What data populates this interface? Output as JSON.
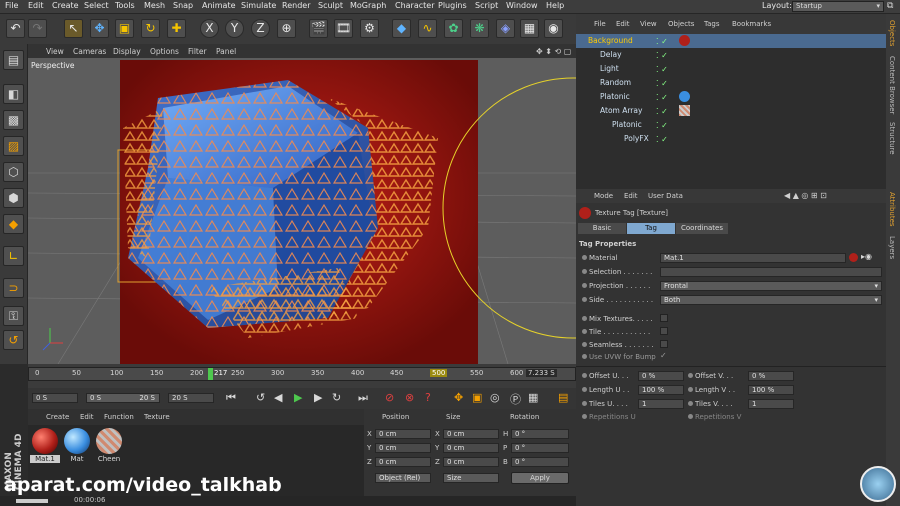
{
  "menu": {
    "items": [
      "File",
      "Edit",
      "Create",
      "Select",
      "Tools",
      "Mesh",
      "Snap",
      "Animate",
      "Simulate",
      "Render",
      "Sculpt",
      "MoGraph",
      "Character",
      "Plugins",
      "Script",
      "Window",
      "Help"
    ],
    "layout_label": "Layout:",
    "layout_value": "Startup"
  },
  "viewport": {
    "menu": [
      "View",
      "Cameras",
      "Display",
      "Options",
      "Filter",
      "Panel"
    ],
    "name": "Perspective"
  },
  "timeline": {
    "ticks": [
      "0",
      "50",
      "100",
      "150",
      "200",
      "250",
      "300",
      "350",
      "400",
      "450",
      "500",
      "550",
      "600"
    ],
    "current_frame": "217",
    "marker": "500",
    "time_readout": "7.233 S"
  },
  "transport": {
    "start": "0 S",
    "range_left": "0 S",
    "range_right": "20 S",
    "end": "20 S"
  },
  "materials": {
    "menu": [
      "Create",
      "Edit",
      "Function",
      "Texture"
    ],
    "items": [
      {
        "label": "Mat.1",
        "color": "#b0201a"
      },
      {
        "label": "Mat",
        "color": "#3a8ee0"
      },
      {
        "label": "Cheen",
        "color": "#c0a090"
      }
    ]
  },
  "coords": {
    "headers": [
      "Position",
      "Size",
      "Rotation"
    ],
    "rows": [
      {
        "axis": "X",
        "pos": "0 cm",
        "size_axis": "X",
        "size": "0 cm",
        "rot_axis": "H",
        "rot": "0 °"
      },
      {
        "axis": "Y",
        "pos": "0 cm",
        "size_axis": "Y",
        "size": "0 cm",
        "rot_axis": "P",
        "rot": "0 °"
      },
      {
        "axis": "Z",
        "pos": "0 cm",
        "size_axis": "Z",
        "size": "0 cm",
        "rot_axis": "B",
        "rot": "0 °"
      }
    ],
    "mode": "Object (Rel)",
    "size_mode": "Size",
    "apply": "Apply"
  },
  "objects": {
    "menu": [
      "File",
      "Edit",
      "View",
      "Objects",
      "Tags",
      "Bookmarks"
    ],
    "rows": [
      {
        "name": "Background",
        "indent": 0,
        "selected": true
      },
      {
        "name": "Delay",
        "indent": 0
      },
      {
        "name": "Light",
        "indent": 0
      },
      {
        "name": "Random",
        "indent": 0
      },
      {
        "name": "Platonic",
        "indent": 0
      },
      {
        "name": "Atom Array",
        "indent": 0
      },
      {
        "name": "Platonic",
        "indent": 1
      },
      {
        "name": "PolyFX",
        "indent": 2
      }
    ]
  },
  "attributes": {
    "menu": [
      "Mode",
      "Edit",
      "User Data"
    ],
    "title": "Texture Tag [Texture]",
    "tabs": [
      "Basic",
      "Tag",
      "Coordinates"
    ],
    "active_tab": "Tag",
    "section": "Tag Properties",
    "material_label": "Material",
    "material_value": "Mat.1",
    "selection_label": "Selection . . . . . . .",
    "projection_label": "Projection . . . . . .",
    "projection_value": "Frontal",
    "side_label": "Side . . . . . . . . . . .",
    "side_value": "Both",
    "mix_label": "Mix Textures. . . . .",
    "tile_label": "Tile . . . . . . . . . . .",
    "seamless_label": "Seamless . . . . . . .",
    "uvw_label": "Use UVW for Bump",
    "offset_u_label": "Offset U. . .",
    "offset_u": "0 %",
    "offset_v_label": "Offset V. . .",
    "offset_v": "0 %",
    "length_u_label": "Length U . .",
    "length_u": "100 %",
    "length_v_label": "Length V . .",
    "length_v": "100 %",
    "tiles_u_label": "Tiles U. . . .",
    "tiles_u": "1",
    "tiles_v_label": "Tiles V. . . .",
    "tiles_v": "1",
    "rep_u_label": "Repetitions U",
    "rep_v_label": "Repetitions V"
  },
  "side_tabs": [
    "Objects",
    "Content Browser",
    "Structure",
    "Attributes",
    "Layers"
  ],
  "status": {
    "time": "00:00:06"
  },
  "watermark": "aparat.com/video_talkhab",
  "brand": "MAXON CINEMA 4D",
  "colors": {
    "accent": "#f5c400",
    "selected": "#5a7fa8",
    "tab_active": "#7fa8d0",
    "cube": "#3a7fd6",
    "background_plane": "#a0140e"
  }
}
